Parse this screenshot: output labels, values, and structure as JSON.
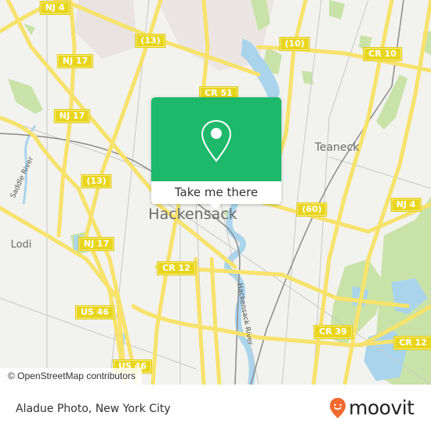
{
  "map": {
    "background_color": "#f2f2ef",
    "road_color": "#f7e26b",
    "water_color": "#a9d4ec",
    "park_color": "#c9e2a8",
    "road_shields": [
      {
        "label": "NJ 4"
      },
      {
        "label": "(13)"
      },
      {
        "label": "(10)"
      },
      {
        "label": "CR 10"
      },
      {
        "label": "NJ 17"
      },
      {
        "label": "CR 51"
      },
      {
        "label": "NJ 17"
      },
      {
        "label": "(13)"
      },
      {
        "label": "(60)"
      },
      {
        "label": "NJ 4"
      },
      {
        "label": "NJ 17"
      },
      {
        "label": "CR 12"
      },
      {
        "label": "US 46"
      },
      {
        "label": "CR 39"
      },
      {
        "label": "CR 12"
      },
      {
        "label": "US 46"
      }
    ],
    "places": [
      {
        "label": "Teaneck"
      },
      {
        "label": "Hackensack"
      },
      {
        "label": "Lodi"
      }
    ],
    "rivers": [
      {
        "label": "Saddle River"
      },
      {
        "label": "Hackensack River"
      }
    ]
  },
  "popup": {
    "icon": "location-pin-icon",
    "action_label": "Take me there",
    "accent_color": "#1db86a"
  },
  "attribution": "© OpenStreetMap contributors",
  "footer": {
    "title": "Aladue Photo, New York City",
    "brand": "moovit",
    "brand_color": "#f26a2e"
  }
}
